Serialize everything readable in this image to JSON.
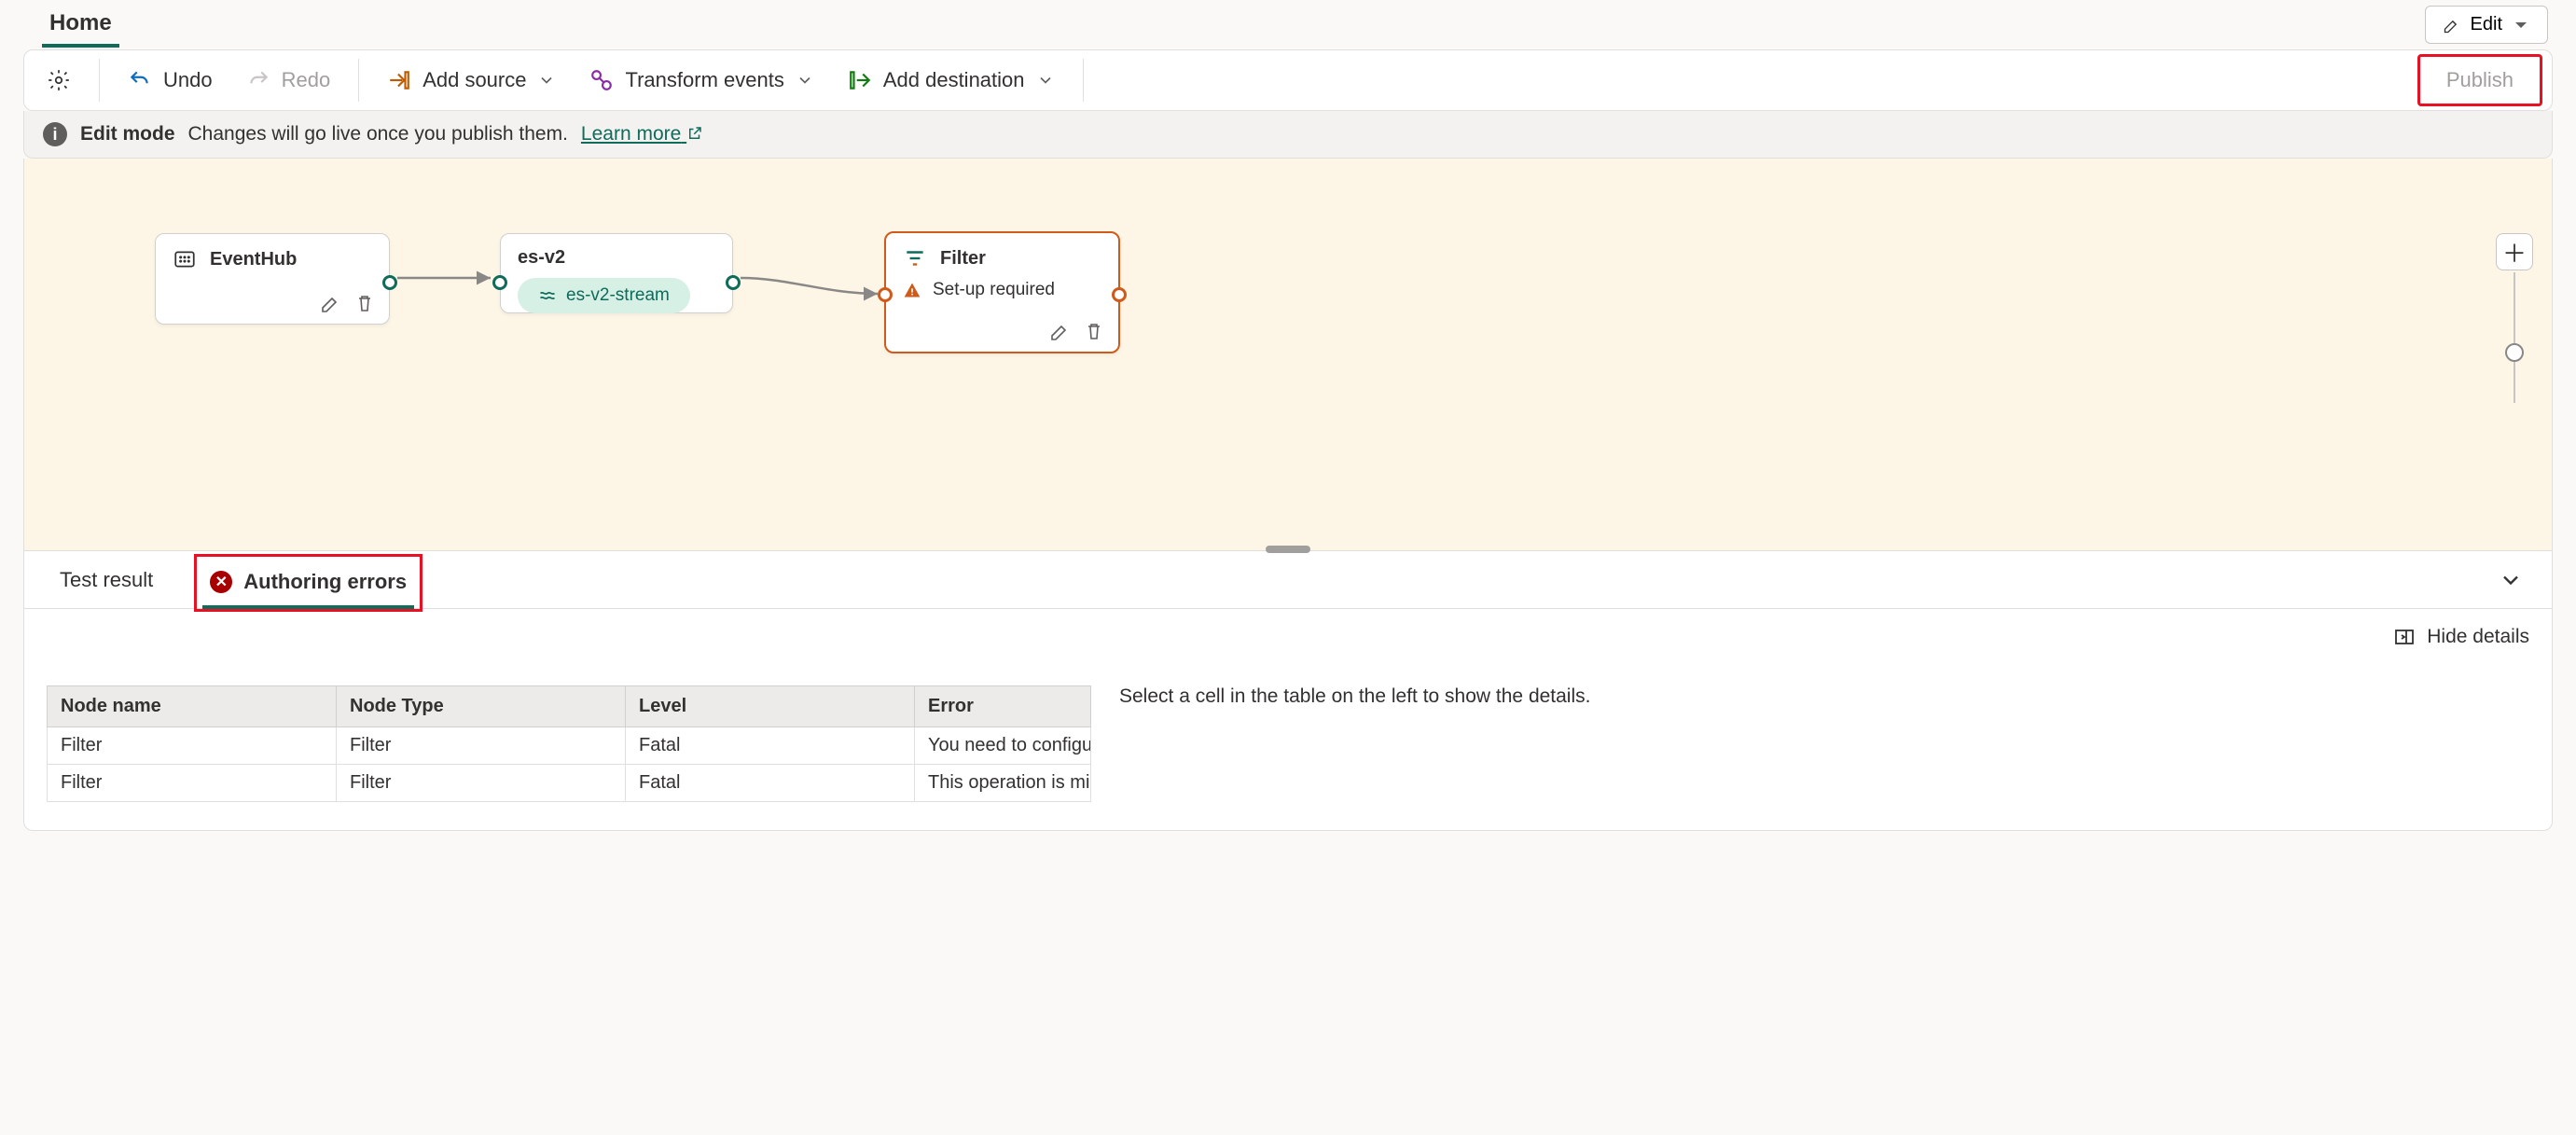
{
  "header": {
    "tab_home": "Home",
    "edit_label": "Edit"
  },
  "toolbar": {
    "undo": "Undo",
    "redo": "Redo",
    "add_source": "Add source",
    "transform": "Transform events",
    "add_destination": "Add destination",
    "publish": "Publish"
  },
  "info_bar": {
    "mode": "Edit mode",
    "msg": "Changes will go live once you publish them.",
    "learn_more": "Learn more"
  },
  "canvas": {
    "node_eventhub": "EventHub",
    "node_esv2": "es-v2",
    "stream_pill": "es-v2-stream",
    "node_filter": "Filter",
    "filter_status": "Set-up required"
  },
  "panel": {
    "tab_test": "Test result",
    "tab_errors": "Authoring errors",
    "hide_details": "Hide details",
    "cols": {
      "name": "Node name",
      "type": "Node Type",
      "level": "Level",
      "error": "Error"
    },
    "rows": [
      {
        "name": "Filter",
        "type": "Filter",
        "level": "Fatal",
        "error": "You need to configure t"
      },
      {
        "name": "Filter",
        "type": "Filter",
        "level": "Fatal",
        "error": "This operation is missin"
      }
    ],
    "detail_hint": "Select a cell in the table on the left to show the details."
  }
}
